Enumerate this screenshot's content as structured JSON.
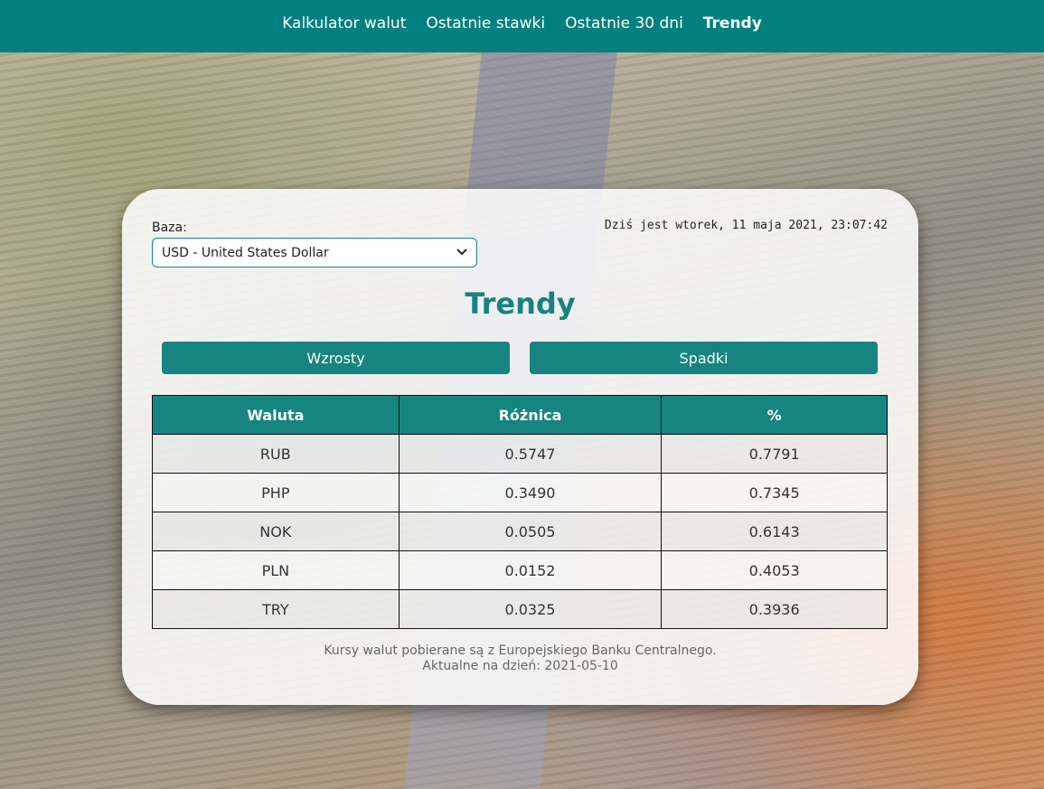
{
  "nav": {
    "items": [
      {
        "label": "Kalkulator walut",
        "active": false
      },
      {
        "label": "Ostatnie stawki",
        "active": false
      },
      {
        "label": "Ostatnie 30 dni",
        "active": false
      },
      {
        "label": "Trendy",
        "active": true
      }
    ]
  },
  "colors": {
    "accent": "#00807f",
    "title": "#178380"
  },
  "card": {
    "base_label": "Baza:",
    "base_select_value": "USD - United States Dollar",
    "date_text": "Dziś jest wtorek, 11 maja 2021, 23:07:42",
    "title": "Trendy",
    "buttons": {
      "up": "Wzrosty",
      "down": "Spadki"
    },
    "table": {
      "headers": [
        "Waluta",
        "Różnica",
        "%"
      ],
      "rows": [
        [
          "RUB",
          "0.5747",
          "0.7791"
        ],
        [
          "PHP",
          "0.3490",
          "0.7345"
        ],
        [
          "NOK",
          "0.0505",
          "0.6143"
        ],
        [
          "PLN",
          "0.0152",
          "0.4053"
        ],
        [
          "TRY",
          "0.0325",
          "0.3936"
        ]
      ]
    },
    "footer": {
      "line1": "Kursy walut pobierane są z Europejskiego Banku Centralnego.",
      "line2": "Aktualne na dzień: 2021-05-10"
    }
  }
}
